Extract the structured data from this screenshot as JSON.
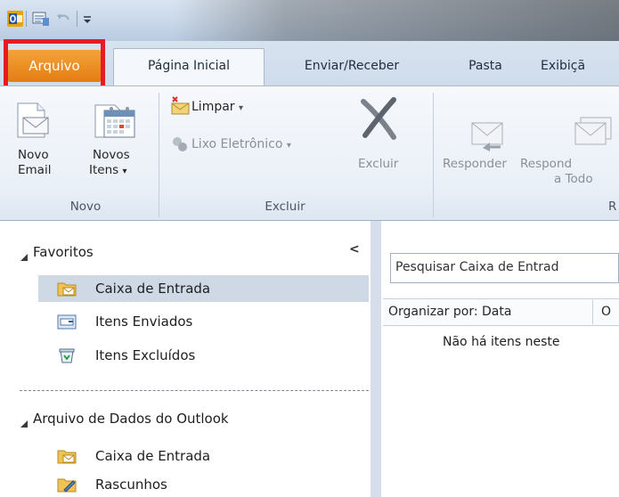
{
  "title_bar": {},
  "tabs": {
    "file": "Arquivo",
    "home": "Página Inicial",
    "send_receive": "Enviar/Receber",
    "folder": "Pasta",
    "view": "Exibiçã"
  },
  "ribbon": {
    "novo_group": {
      "title": "Novo",
      "new_email_line1": "Novo",
      "new_email_line2": "Email",
      "new_items_line1": "Novos",
      "new_items_line2": "Itens",
      "dropdown_glyph": "▾"
    },
    "excluir_group": {
      "title": "Excluir",
      "limpar": "Limpar",
      "lixo": "Lixo Eletrônico",
      "excluir": "Excluir"
    },
    "responder_group": {
      "responder": "Responder",
      "responder_todos_line1": "Respond",
      "responder_todos_line2": "a Todo",
      "title_partial": "R"
    }
  },
  "nav": {
    "collapse_glyph": "<",
    "favoritos": "Favoritos",
    "fav_items": [
      "Caixa de Entrada",
      "Itens Enviados",
      "Itens Excluídos"
    ],
    "data_file": "Arquivo de Dados do Outlook",
    "data_items": [
      "Caixa de Entrada",
      "Rascunhos"
    ]
  },
  "main": {
    "search_placeholder": "Pesquisar Caixa de Entrad",
    "sort_label": "Organizar por: Data",
    "sort_second": "O",
    "empty_message": "Não há itens neste"
  },
  "colors": {
    "file_tab": "#e88a1a",
    "highlight_box": "#e51c24",
    "selected_row": "#cfd9e6"
  }
}
